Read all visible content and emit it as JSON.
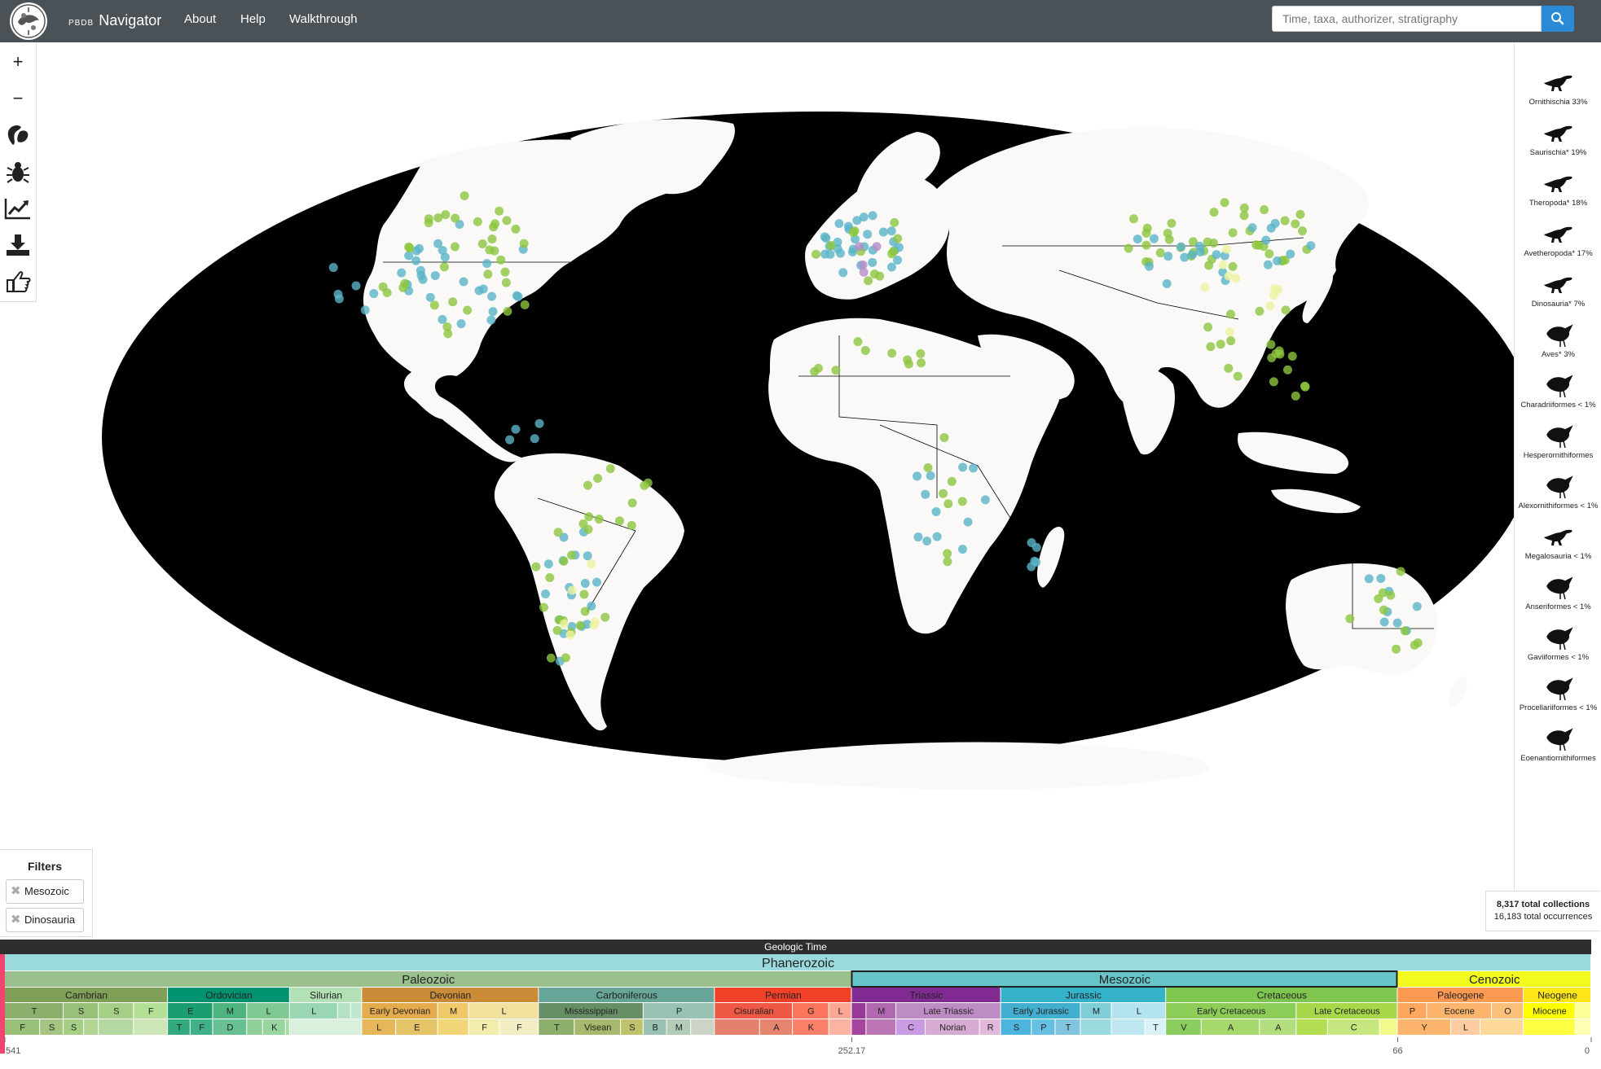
{
  "header": {
    "brand_small": "PBDB",
    "brand_big": "Navigator",
    "nav": [
      "About",
      "Help",
      "Walkthrough"
    ],
    "search_placeholder": "Time, taxa, authorizer, stratigraphy"
  },
  "toolbar": {
    "zoom_in": "+",
    "zoom_out": "−",
    "tools": [
      "paleogeography-icon",
      "taxa-filter-icon",
      "diversity-chart-icon",
      "download-icon",
      "gesture-icon"
    ]
  },
  "taxa": [
    {
      "label": "Ornithischia 33%"
    },
    {
      "label": "Saurischia* 19%"
    },
    {
      "label": "Theropoda* 18%"
    },
    {
      "label": "Avetheropoda* 17%"
    },
    {
      "label": "Dinosauria* 7%"
    },
    {
      "label": "Aves* 3%"
    },
    {
      "label": "Charadriiformes < 1%"
    },
    {
      "label": "Hesperornithiformes"
    },
    {
      "label": "Alexornithiformes < 1%"
    },
    {
      "label": "Megalosauria < 1%"
    },
    {
      "label": "Anseriformes < 1%"
    },
    {
      "label": "Gaviiformes < 1%"
    },
    {
      "label": "Procellariiformes < 1%"
    },
    {
      "label": "Eoenantiornithiformes"
    }
  ],
  "filters": {
    "title": "Filters",
    "items": [
      "Mesozoic",
      "Dinosauria"
    ]
  },
  "totals": {
    "collections": "8,317 total collections",
    "occurrences": "16,183 total occurrences"
  },
  "colors": {
    "header_bg": "#4a5157",
    "search_button": "#2a8ad6",
    "ocean": "#000000",
    "land": "#faf9f7",
    "dot_green": "#8cc63f",
    "dot_blue": "#5ab4c8",
    "dot_yellow": "#eef2a0",
    "dot_purple": "#b58bc9"
  },
  "timescale": {
    "title": "Geologic Time",
    "eon": "Phanerozoic",
    "eras": [
      {
        "name": "Paleozoic",
        "start": 541,
        "end": 252.17,
        "color": "#99c08d"
      },
      {
        "name": "Mesozoic",
        "start": 252.17,
        "end": 66,
        "color": "#67c5ca",
        "selected": true
      },
      {
        "name": "Cenozoic",
        "start": 66,
        "end": 0,
        "color": "#f2f91d"
      }
    ],
    "periods": [
      {
        "name": "Cambrian",
        "start": 541,
        "end": 485.4,
        "color": "#7fa056"
      },
      {
        "name": "Ordovician",
        "start": 485.4,
        "end": 443.8,
        "color": "#009270"
      },
      {
        "name": "Silurian",
        "start": 443.8,
        "end": 419.2,
        "color": "#b3e1b6"
      },
      {
        "name": "Devonian",
        "start": 419.2,
        "end": 358.9,
        "color": "#cb8c37"
      },
      {
        "name": "Carboniferous",
        "start": 358.9,
        "end": 298.9,
        "color": "#67a599"
      },
      {
        "name": "Permian",
        "start": 298.9,
        "end": 252.17,
        "color": "#f04028"
      },
      {
        "name": "Triassic",
        "start": 252.17,
        "end": 201.3,
        "color": "#812b92"
      },
      {
        "name": "Jurassic",
        "start": 201.3,
        "end": 145,
        "color": "#34b2c9"
      },
      {
        "name": "Cretaceous",
        "start": 145,
        "end": 66,
        "color": "#7fc64e"
      },
      {
        "name": "Paleogene",
        "start": 66,
        "end": 23.03,
        "color": "#fd9a52"
      },
      {
        "name": "Neogene",
        "start": 23.03,
        "end": 0,
        "color": "#ffe619"
      }
    ],
    "epochs": [
      {
        "name": "T",
        "start": 541,
        "end": 521,
        "color": "#8cb06c"
      },
      {
        "name": "S",
        "start": 521,
        "end": 509,
        "color": "#99c078"
      },
      {
        "name": "S",
        "start": 509,
        "end": 497,
        "color": "#a6cf86"
      },
      {
        "name": "F",
        "start": 497,
        "end": 485.4,
        "color": "#b3e095"
      },
      {
        "name": "E",
        "start": 485.4,
        "end": 470,
        "color": "#1a9d6f"
      },
      {
        "name": "M",
        "start": 470,
        "end": 458.4,
        "color": "#4db47e"
      },
      {
        "name": "L",
        "start": 458.4,
        "end": 443.8,
        "color": "#7fca93"
      },
      {
        "name": "L",
        "start": 443.8,
        "end": 427.4,
        "color": "#99d7b3"
      },
      {
        "name": "",
        "start": 427.4,
        "end": 423,
        "color": "#b3e1c2"
      },
      {
        "name": "",
        "start": 423,
        "end": 419.2,
        "color": "#bfe6cf"
      },
      {
        "name": "Early Devonian",
        "start": 419.2,
        "end": 393.3,
        "color": "#e5ac4d"
      },
      {
        "name": "M",
        "start": 393.3,
        "end": 382.7,
        "color": "#f1c868"
      },
      {
        "name": "L",
        "start": 382.7,
        "end": 358.9,
        "color": "#f1e19d"
      },
      {
        "name": "Mississippian",
        "start": 358.9,
        "end": 323.2,
        "color": "#678f66"
      },
      {
        "name": "P",
        "start": 323.2,
        "end": 298.9,
        "color": "#99c2b5"
      },
      {
        "name": "Cisuralian",
        "start": 298.9,
        "end": 272.3,
        "color": "#ef5845"
      },
      {
        "name": "G",
        "start": 272.3,
        "end": 259.9,
        "color": "#fb745c"
      },
      {
        "name": "L",
        "start": 259.9,
        "end": 252.17,
        "color": "#fba794"
      },
      {
        "name": "",
        "start": 252.17,
        "end": 247.2,
        "color": "#983999"
      },
      {
        "name": "M",
        "start": 247.2,
        "end": 237,
        "color": "#b168b1"
      },
      {
        "name": "Late Triassic",
        "start": 237,
        "end": 201.3,
        "color": "#bd8cc3"
      },
      {
        "name": "Early Jurassic",
        "start": 201.3,
        "end": 174.1,
        "color": "#42aed0"
      },
      {
        "name": "M",
        "start": 174.1,
        "end": 163.5,
        "color": "#80cfd8"
      },
      {
        "name": "L",
        "start": 163.5,
        "end": 145,
        "color": "#b3e3ee"
      },
      {
        "name": "Early Cretaceous",
        "start": 145,
        "end": 100.5,
        "color": "#8ccd57"
      },
      {
        "name": "Late Cretaceous",
        "start": 100.5,
        "end": 66,
        "color": "#a6d84a"
      },
      {
        "name": "P",
        "start": 66,
        "end": 56,
        "color": "#fda75f"
      },
      {
        "name": "Eocene",
        "start": 56,
        "end": 33.9,
        "color": "#fdb46c"
      },
      {
        "name": "O",
        "start": 33.9,
        "end": 23.03,
        "color": "#fdc07a"
      },
      {
        "name": "Miocene",
        "start": 23.03,
        "end": 5.33,
        "color": "#ffff00"
      },
      {
        "name": "",
        "start": 5.33,
        "end": 0,
        "color": "#ffff99"
      }
    ],
    "stages": [
      {
        "name": "F",
        "start": 541,
        "end": 529,
        "color": "#99c078"
      },
      {
        "name": "S",
        "start": 529,
        "end": 521,
        "color": "#a6c583"
      },
      {
        "name": "S",
        "start": 521,
        "end": 514,
        "color": "#a6cf86"
      },
      {
        "name": "",
        "start": 514,
        "end": 509,
        "color": "#b3d492"
      },
      {
        "name": "",
        "start": 509,
        "end": 497,
        "color": "#b3d9a1"
      },
      {
        "name": "",
        "start": 497,
        "end": 485.4,
        "color": "#cce6b8"
      },
      {
        "name": "T",
        "start": 485.4,
        "end": 477.7,
        "color": "#33a97e"
      },
      {
        "name": "F",
        "start": 477.7,
        "end": 470,
        "color": "#41b087"
      },
      {
        "name": "D",
        "start": 470,
        "end": 458.4,
        "color": "#66c092"
      },
      {
        "name": "",
        "start": 458.4,
        "end": 453,
        "color": "#8fd09a"
      },
      {
        "name": "K",
        "start": 453,
        "end": 445.2,
        "color": "#99d69f"
      },
      {
        "name": "",
        "start": 445.2,
        "end": 443.8,
        "color": "#a6dba4"
      },
      {
        "name": "",
        "start": 443.8,
        "end": 419.2,
        "color": "#d9f0dd"
      },
      {
        "name": "L",
        "start": 419.2,
        "end": 407.6,
        "color": "#e5b75a"
      },
      {
        "name": "E",
        "start": 407.6,
        "end": 393.3,
        "color": "#e5c468"
      },
      {
        "name": "",
        "start": 393.3,
        "end": 382.7,
        "color": "#f1d576"
      },
      {
        "name": "F",
        "start": 382.7,
        "end": 372.2,
        "color": "#f2edad"
      },
      {
        "name": "F",
        "start": 372.2,
        "end": 358.9,
        "color": "#f2edc5"
      },
      {
        "name": "T",
        "start": 358.9,
        "end": 346.7,
        "color": "#8cb06c"
      },
      {
        "name": "Visean",
        "start": 346.7,
        "end": 330.9,
        "color": "#a6b96c"
      },
      {
        "name": "S",
        "start": 330.9,
        "end": 323.2,
        "color": "#bfc26b"
      },
      {
        "name": "B",
        "start": 323.2,
        "end": 315.2,
        "color": "#99c2b5"
      },
      {
        "name": "M",
        "start": 315.2,
        "end": 307,
        "color": "#b3cbb9"
      },
      {
        "name": "",
        "start": 307,
        "end": 298.9,
        "color": "#ccd4c7"
      },
      {
        "name": "",
        "start": 298.9,
        "end": 283.5,
        "color": "#e5806d"
      },
      {
        "name": "A",
        "start": 283.5,
        "end": 272.3,
        "color": "#e5846f"
      },
      {
        "name": "K",
        "start": 272.3,
        "end": 259.9,
        "color": "#fb8069"
      },
      {
        "name": "",
        "start": 259.9,
        "end": 252.17,
        "color": "#fcb4a2"
      },
      {
        "name": "",
        "start": 252.17,
        "end": 247.2,
        "color": "#a4469f"
      },
      {
        "name": "",
        "start": 247.2,
        "end": 237,
        "color": "#bc75b5"
      },
      {
        "name": "C",
        "start": 237,
        "end": 227,
        "color": "#c99be3"
      },
      {
        "name": "Norian",
        "start": 227,
        "end": 208.5,
        "color": "#d6aad3"
      },
      {
        "name": "R",
        "start": 208.5,
        "end": 201.3,
        "color": "#e3b9db"
      },
      {
        "name": "S",
        "start": 201.3,
        "end": 190.8,
        "color": "#4db5dd"
      },
      {
        "name": "P",
        "start": 190.8,
        "end": 182.7,
        "color": "#66c0e4"
      },
      {
        "name": "T",
        "start": 182.7,
        "end": 174.1,
        "color": "#80c5dd"
      },
      {
        "name": "",
        "start": 174.1,
        "end": 163.5,
        "color": "#9ad9dd"
      },
      {
        "name": "",
        "start": 163.5,
        "end": 152.1,
        "color": "#bfe7f1"
      },
      {
        "name": "T",
        "start": 152.1,
        "end": 145,
        "color": "#d9f1f7"
      },
      {
        "name": "V",
        "start": 145,
        "end": 132.9,
        "color": "#8ccd60"
      },
      {
        "name": "A",
        "start": 132.9,
        "end": 113,
        "color": "#a6d96c"
      },
      {
        "name": "A",
        "start": 113,
        "end": 100.5,
        "color": "#b3de7f"
      },
      {
        "name": "",
        "start": 100.5,
        "end": 89.8,
        "color": "#b3de53"
      },
      {
        "name": "C",
        "start": 89.8,
        "end": 72.1,
        "color": "#c6e680"
      },
      {
        "name": "",
        "start": 72.1,
        "end": 66,
        "color": "#f2fa8c"
      },
      {
        "name": "Y",
        "start": 66,
        "end": 47.8,
        "color": "#fdb46c"
      },
      {
        "name": "L",
        "start": 47.8,
        "end": 37.8,
        "color": "#fdcda1"
      },
      {
        "name": "",
        "start": 37.8,
        "end": 23.03,
        "color": "#fed99a"
      },
      {
        "name": "",
        "start": 23.03,
        "end": 5.33,
        "color": "#ffff41"
      },
      {
        "name": "",
        "start": 5.33,
        "end": 0,
        "color": "#ffffb3"
      }
    ],
    "axis_ticks": [
      "541",
      "252.17",
      "66",
      "0"
    ]
  }
}
